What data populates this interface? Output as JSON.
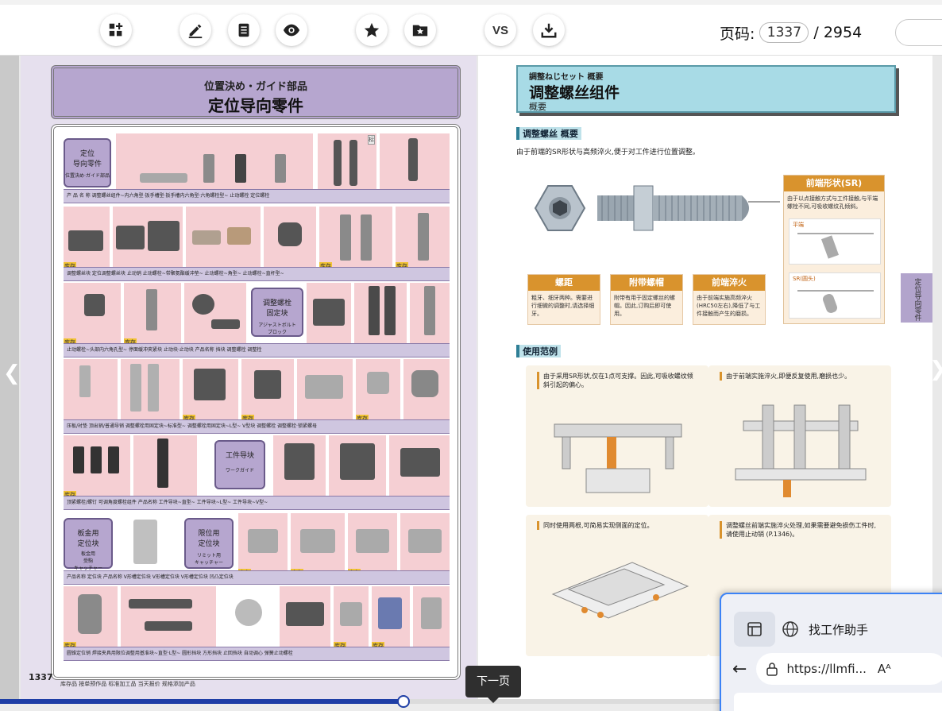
{
  "toolbar": {
    "buttons": [
      {
        "name": "thumbnails-button",
        "icon": "grid-plus-icon"
      },
      {
        "name": "annotate-button",
        "icon": "pencil-icon"
      },
      {
        "name": "notes-button",
        "icon": "document-icon"
      },
      {
        "name": "view-button",
        "icon": "eye-icon"
      },
      {
        "name": "favorite-button",
        "icon": "star-icon"
      },
      {
        "name": "collection-button",
        "icon": "folder-star-icon"
      },
      {
        "name": "compare-button",
        "label": "VS"
      },
      {
        "name": "download-button",
        "icon": "download-icon"
      }
    ],
    "compare_label": "VS",
    "page_label": "页码:",
    "current_page": "1337",
    "page_separator": "/ 2954"
  },
  "left_page": {
    "header_jp": "位置決め・ガイド部品",
    "header_cn": "定位导向零件",
    "categories": {
      "c1": "定位\n导向零件",
      "c1_sub": "位置決め·ガイド部品",
      "c2": "调整螺栓\n固定块",
      "c2_sub": "アジャストボルト\nブロック",
      "c3": "工件导块",
      "c3_sub": "ワークガイド",
      "c4": "板金用\n定位块",
      "c4_sub": "板金用\n受駒\nキャッチャー",
      "c5": "限位用\n定位块",
      "c5_sub": "リミット用\nキャッチャー"
    },
    "row_labels": [
      "产 品 名 称   调整螺丝组件~内六角型·扳手槽型·扳手槽内六角型·六角螺栓型~   止动螺栓   定位螺栓",
      "调整螺丝块   定位调整螺丝块   止动销   止动螺栓~带聚氨酯缓冲垫~   止动螺栓~角型~   止动螺栓~直杆型~",
      "止动螺栓~头部内六角孔型~   停面缓冲夹紧块   止动块·止动块   产品名称   挡块   调整螺栓   调整栓",
      "压板/衬垫   顶出销/普通导销   调整螺栓用固定块~标准型~   调整螺栓用固定块~L型~   V型块   调整螺栓   调整螺栓·锁紧螺母",
      "顶紧螺栓/螺钉   可调角度螺栓组件   产品名称   工件导块~直型~   工件导块~L型~   工件导块~V型~",
      "产品名称   定位块   产品名称   V形槽定位块   V形槽定位块   V形槽定位块   凹凸定位块",
      "圆锥定位销   焊接夹具用限位调整用基准块~直型·L型~   圆形挡块   方形挡块   止回挡块   自动调心   弹簧止动螺栓"
    ],
    "page_number": "1337",
    "legend": "库存品  按单预作品  标准加工品  当天报价  规格添加产品",
    "tags": {
      "stock": "库存",
      "made": "制",
      "standard": "标"
    }
  },
  "right_page": {
    "header_jp": "調整ねじセット 概要",
    "header_cn": "调整螺丝组件",
    "header_sub": "概要",
    "section1_title": "调整螺丝 概要",
    "section1_text": "由于前端的SR形状与高频淬火,便于对工件进行位置调整。",
    "callouts": [
      {
        "title": "螺距",
        "text": "粗牙、细牙两种。需要进行细微的调整时,请选择细牙。"
      },
      {
        "title": "附带螺帽",
        "text": "附带有用于固定螺丝的螺帽。因此,订购后即可使用。"
      },
      {
        "title": "前端淬火",
        "text": "由于前端实施高频淬火(HRC50左右),降低了与工件接触而产生的磨损。"
      }
    ],
    "sr_box": {
      "title": "前端形状(SR)",
      "text": "由于以点接触方式与工件接触,与平端螺栓不同,可吸收螺纹孔倾斜。",
      "sub1": "平端",
      "sub2": "SR(圆头)"
    },
    "section2_title": "使用范例",
    "examples": [
      "由于采用SR形状,仅在1点可支撑。因此,可吸收螺纹倾斜引起的偏心。",
      "由于前端实施淬火,即便反复使用,磨损也少。",
      "同时使用两根,可简易实现侧面的定位。",
      "调整螺丝前端实施淬火处理,如果需要避免损伤工件时,请使用止动销 (P.1346)。"
    ],
    "side_tab": "定位导向零件"
  },
  "navigation": {
    "next_tooltip": "下一页",
    "progress_fraction": 0.428
  },
  "float_window": {
    "tab_title": "找工作助手",
    "url": "https://llmfi...",
    "read_aloud": "Aᴬ"
  }
}
